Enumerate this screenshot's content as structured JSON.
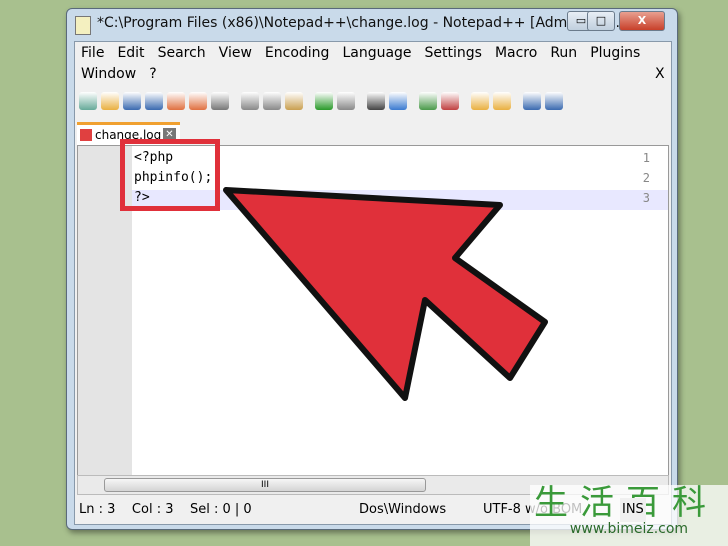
{
  "window": {
    "title": "*C:\\Program Files (x86)\\Notepad++\\change.log - Notepad++ [Administra...",
    "minimize": "▭",
    "maximize": "□",
    "close": "X"
  },
  "menu": {
    "items": [
      "File",
      "Edit",
      "Search",
      "View",
      "Encoding",
      "Language",
      "Settings",
      "Macro",
      "Run",
      "Plugins"
    ],
    "row2": [
      "Window",
      "?"
    ],
    "close_doc": "X"
  },
  "toolbar": {
    "icons": [
      "new-icon",
      "open-icon",
      "save-icon",
      "save-all-icon",
      "close-icon",
      "close-all-icon",
      "print-icon",
      "cut-icon",
      "copy-icon",
      "paste-icon",
      "undo-icon",
      "redo-icon",
      "find-icon",
      "replace-icon",
      "zoom-in-icon",
      "zoom-out-icon",
      "sync-v-icon",
      "sync-h-icon",
      "wrap-icon",
      "show-all-chars-icon"
    ]
  },
  "tab": {
    "label": "change.log",
    "close": "✕"
  },
  "editor": {
    "lines": [
      {
        "num": "1",
        "text": "<?php"
      },
      {
        "num": "2",
        "text": "phpinfo();"
      },
      {
        "num": "3",
        "text": "?>"
      }
    ]
  },
  "scrollbar": {
    "grip": "III"
  },
  "status": {
    "position": "Ln : 3    Col : 3    Sel : 0 | 0",
    "eol": "Dos\\Windows",
    "encoding": "UTF-8 w/o BOM",
    "mode": "INS"
  },
  "watermark": {
    "text": "生活百科",
    "url": "www.bimeiz.com"
  },
  "colors": {
    "arrow": "#e0303a",
    "highlight_box": "#e0303a"
  }
}
